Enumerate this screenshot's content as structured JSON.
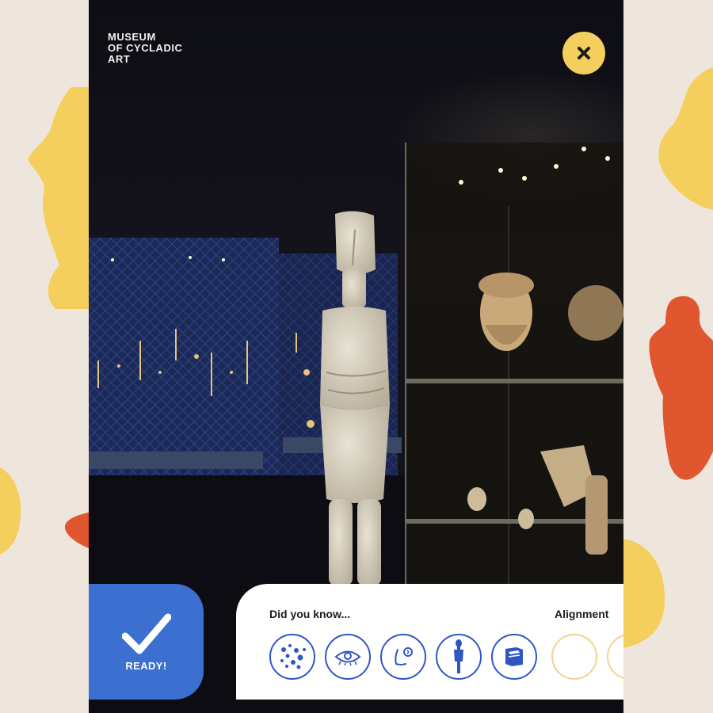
{
  "app": {
    "logo_lines": [
      "MUSEUM",
      "OF CYCLADIC",
      "ART"
    ]
  },
  "actions": {
    "close_icon": "close-icon",
    "ready_label": "READY!",
    "ready_icon": "checkmark-icon"
  },
  "info_card": {
    "did_you_know_label": "Did you know...",
    "alignment_label": "Alignment",
    "icons": [
      "islands-map-icon",
      "eye-icon",
      "ear-icon",
      "figurine-icon",
      "book-icon"
    ]
  },
  "colors": {
    "background": "#eee6dc",
    "accent_yellow": "#f5cf5e",
    "accent_orange": "#e0562f",
    "accent_blue": "#3b6fd0",
    "icon_blue": "#2f57c4"
  }
}
